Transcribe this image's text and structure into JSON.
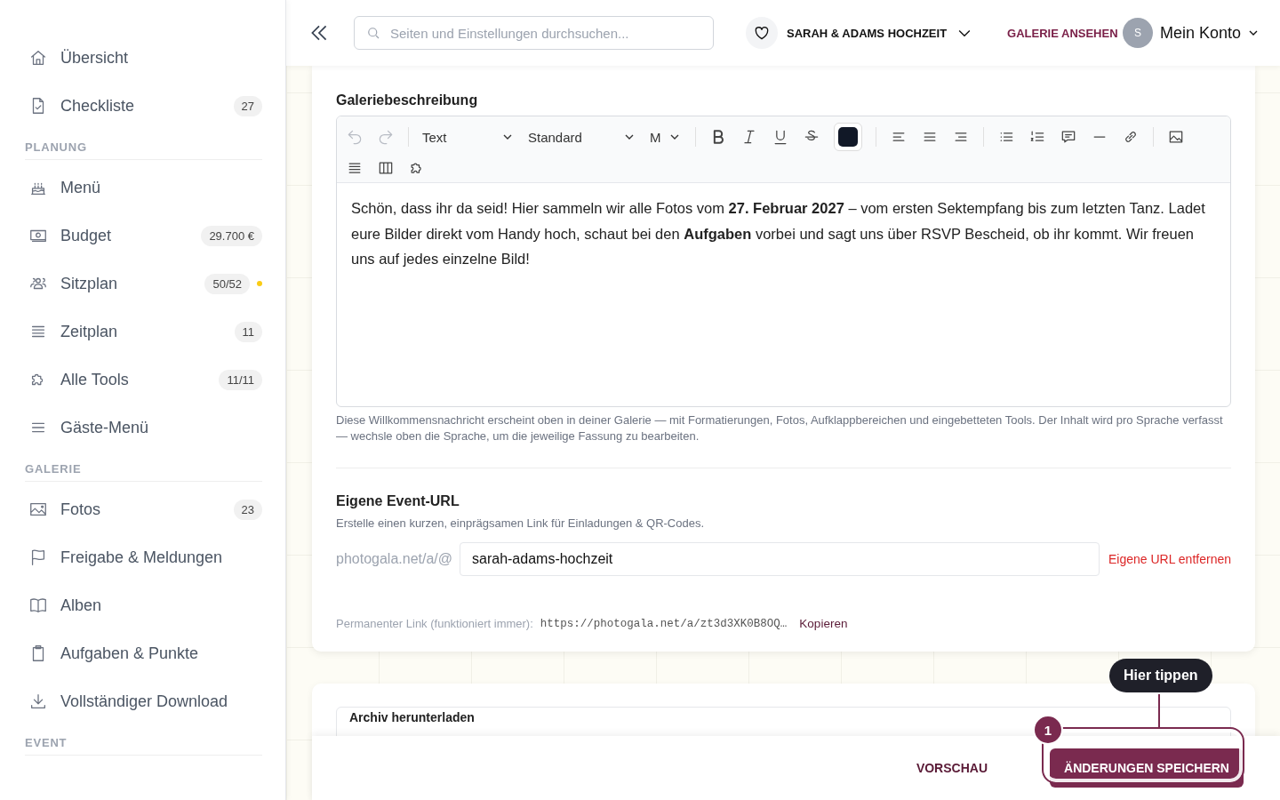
{
  "sidebar": {
    "sections": [
      {
        "items": [
          {
            "label": "Übersicht",
            "alert": false,
            "selected": false
          },
          {
            "label": "Checkliste",
            "badge": "27",
            "alert": false,
            "selected": false
          }
        ]
      },
      {
        "heading": "PLANUNG",
        "items": [
          {
            "label": "Menü",
            "alert": false,
            "selected": false
          },
          {
            "label": "Budget",
            "badge": "29.700 €",
            "alert": false,
            "selected": false
          },
          {
            "label": "Sitzplan",
            "badge": "50/52",
            "alert": true,
            "selected": false
          },
          {
            "label": "Zeitplan",
            "badge": "11",
            "alert": false,
            "selected": false
          },
          {
            "label": "Alle Tools",
            "badge": "11/11",
            "alert": false,
            "selected": false
          },
          {
            "label": "Gäste-Menü",
            "alert": false,
            "selected": false
          }
        ]
      },
      {
        "heading": "GALERIE",
        "items": [
          {
            "label": "Fotos",
            "badge": "23",
            "alert": false,
            "selected": false
          },
          {
            "label": "Freigabe & Meldungen",
            "alert": false,
            "selected": false
          },
          {
            "label": "Alben",
            "alert": false,
            "selected": false
          },
          {
            "label": "Aufgaben & Punkte",
            "alert": false,
            "selected": false
          },
          {
            "label": "Vollständiger Download",
            "alert": false,
            "selected": false
          }
        ]
      },
      {
        "heading": "EVENT"
      }
    ]
  },
  "header": {
    "search": {
      "placeholder": "Seiten und Einstellungen durchsuchen..."
    },
    "event": "SARAH & ADAMS HOCHZEIT",
    "view_gallery": "GALERIE ANSEHEN",
    "avatar": "S",
    "account": "Mein Konto"
  },
  "description": {
    "label": "Galeriebeschreibung",
    "toolbar": {
      "undo_disabled": true,
      "redo_disabled": true,
      "block": "Text",
      "font": "Standard",
      "size": "M",
      "color": "#111827"
    },
    "content": "Schön, dass ihr da seid! Hier sammeln wir alle Fotos vom **27. Februar 2027** – vom ersten Sektempfang bis zum letzten Tanz. Ladet eure Bilder direkt vom Handy hoch, schaut bei den **Aufgaben** vorbei und sagt uns über RSVP Bescheid, ob ihr kommt. Wir freuen uns auf jedes einzelne Bild!",
    "help": "Diese Willkommensnachricht erscheint oben in deiner Galerie — mit Formatierungen, Fotos, Aufklappbereichen und eingebetteten Tools. Der Inhalt wird pro Sprache verfasst — wechsle oben die Sprache, um die jeweilige Fassung zu bearbeiten."
  },
  "custom_url": {
    "title": "Eigene Event-URL",
    "subtitle": "Erstelle einen kurzen, einprägsamen Link für Einladungen & QR-Codes.",
    "prefix": "photogala.net/a/@",
    "value": "sarah-adams-hochzeit",
    "remove": "Eigene URL entfernen",
    "permalink_label": "Permanenter Link (funktioniert immer):",
    "permalink": "https://photogala.net/a/zt3d3XK0B8OQ…",
    "copy": "Kopieren"
  },
  "archive": {
    "title": "Archiv herunterladen"
  },
  "footer": {
    "preview": "VORSCHAU",
    "save": "ÄNDERUNGEN SPEICHERN"
  },
  "tour": {
    "tooltip": "Hier tippen",
    "step": "1"
  }
}
